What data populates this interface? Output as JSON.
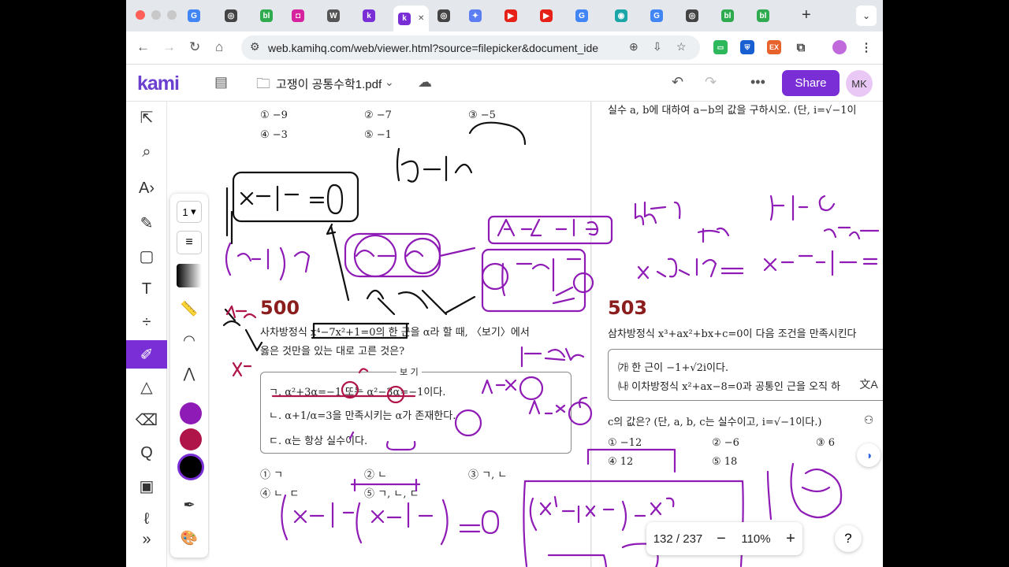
{
  "browser": {
    "url": "web.kamihq.com/web/viewer.html?source=filepicker&document_ident...",
    "tabs": [
      {
        "icon": "google-icon",
        "label": "G",
        "color": "#4285f4"
      },
      {
        "icon": "chatgpt-icon",
        "label": "◎",
        "color": "#444"
      },
      {
        "icon": "bl-icon",
        "label": "bl",
        "color": "#2eaa4f"
      },
      {
        "icon": "instagram-icon",
        "label": "◘",
        "color": "#d6249f"
      },
      {
        "icon": "wikipedia-icon",
        "label": "W",
        "color": "#555"
      },
      {
        "icon": "kami-icon",
        "label": "k",
        "color": "#7a2fd6"
      },
      {
        "icon": "kami-icon",
        "label": "k",
        "color": "#7a2fd6"
      },
      {
        "icon": "chatgpt-icon",
        "label": "◎",
        "color": "#444"
      },
      {
        "icon": "gemini-icon",
        "label": "✦",
        "color": "#5b7ff2"
      },
      {
        "icon": "youtube-icon",
        "label": "▶",
        "color": "#e62117"
      },
      {
        "icon": "youtube-icon",
        "label": "▶",
        "color": "#e62117"
      },
      {
        "icon": "google-icon",
        "label": "G",
        "color": "#4285f4"
      },
      {
        "icon": "app-icon",
        "label": "◉",
        "color": "#1aa5a8"
      },
      {
        "icon": "google-icon",
        "label": "G",
        "color": "#4285f4"
      },
      {
        "icon": "chatgpt-icon",
        "label": "◎",
        "color": "#444"
      },
      {
        "icon": "bl-icon",
        "label": "bl",
        "color": "#2eaa4f"
      },
      {
        "icon": "bl-icon",
        "label": "bl",
        "color": "#2eaa4f"
      }
    ]
  },
  "kami": {
    "logo": "kami",
    "doc_name": "고쟁이 공통수학1.pdf",
    "share": "Share",
    "avatar": "MK",
    "page_indicator": "132 / 237",
    "zoom": "110%",
    "help": "?",
    "accent": "#7a2fd6"
  },
  "subpanel": {
    "stroke_size": "1",
    "colors": [
      "#8e1bb5",
      "#b0154a",
      "#000000"
    ]
  },
  "document": {
    "top_choices": [
      "① −9",
      "② −7",
      "③ −5",
      "④ −3",
      "⑤ −1"
    ],
    "q500_num": "500",
    "q500_line1": "사차방정식 x⁴−7x²+1=0의 한 근을 α라 할 때, 〈보기〉에서",
    "q500_line2": "옳은 것만을 있는 대로 고른 것은?",
    "bogi_title": "보 기",
    "bogi_items": [
      "ㄱ. α²+3α=−1 또는 α²−3α=−1이다.",
      "ㄴ. α+1/α=3을 만족시키는 α가 존재한다.",
      "ㄷ. α는 항상 실수이다."
    ],
    "q500_choices": [
      "① ㄱ",
      "② ㄴ",
      "③ ㄱ, ㄴ",
      "④ ㄴ, ㄷ",
      "⑤ ㄱ, ㄴ, ㄷ"
    ],
    "right_top": "실수 a, b에 대하여 a−b의 값을 구하시오. (단, i=√−1이",
    "q503_num": "503",
    "q503_line1": "삼차방정식 x³+ax²+bx+c=0이 다음 조건을 만족시킨다",
    "q503_cond1": "㈎ 한 근이 −1+√2i이다.",
    "q503_cond2": "㈏ 이차방정식 x²+ax−8=0과 공통인 근을 오직 하",
    "q503_line2": "c의 값은? (단, a, b, c는 실수이고, i=√−1이다.)",
    "q503_choices": [
      "① −12",
      "② −6",
      "③ 6",
      "④ 12",
      "⑤ 18"
    ]
  }
}
